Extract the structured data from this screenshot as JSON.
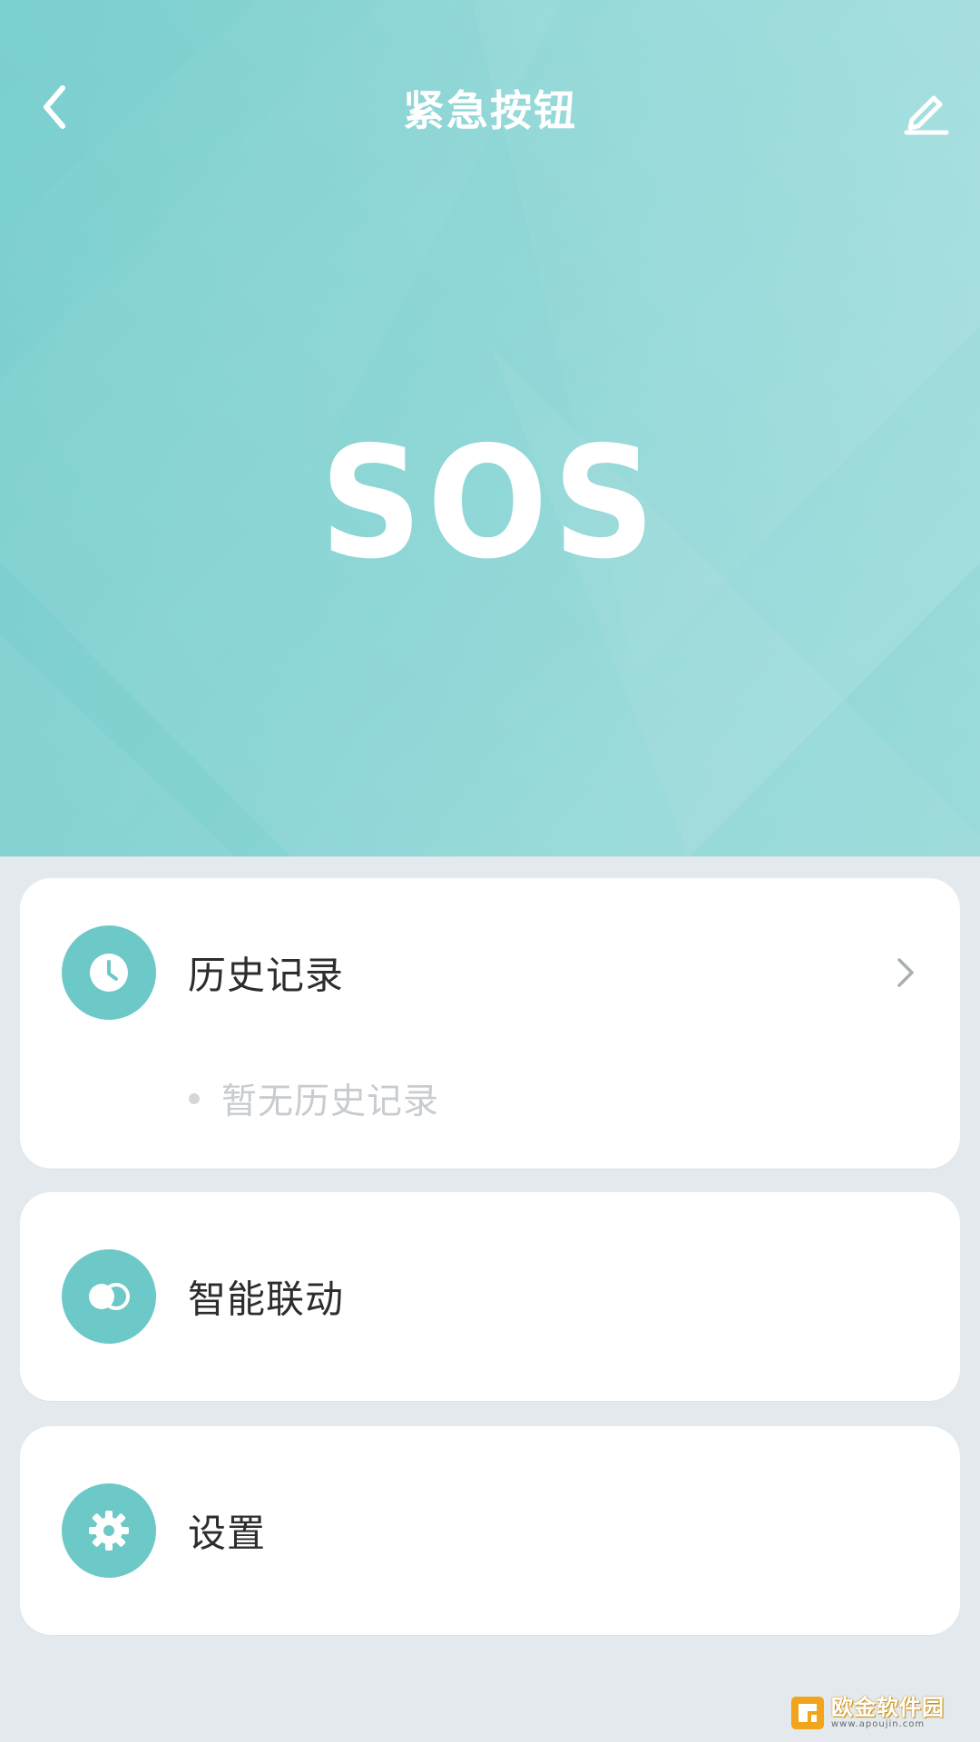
{
  "header": {
    "title": "紧急按钮",
    "hero_text": "SOS"
  },
  "colors": {
    "accent": "#6dc8c8",
    "hero_bg": "#72cccc",
    "background": "#e3e9ed",
    "card_bg": "#ffffff",
    "label_text": "#2d2d2d",
    "muted_text": "#c8ccd0"
  },
  "icons": {
    "back": "chevron-left-icon",
    "edit": "pencil-icon",
    "history": "clock-icon",
    "linkage": "toggle-icon",
    "settings": "gear-icon",
    "history_arrow": "chevron-right-icon"
  },
  "sections": {
    "history": {
      "label": "历史记录",
      "empty_text": "暂无历史记录"
    },
    "linkage": {
      "label": "智能联动"
    },
    "settings": {
      "label": "设置"
    }
  },
  "watermark": {
    "main": "欧金软件园",
    "sub": "www.apoujin.com"
  }
}
